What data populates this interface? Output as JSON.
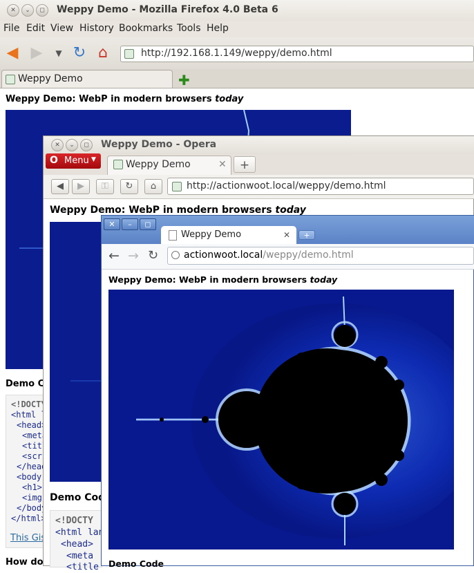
{
  "firefox": {
    "title": "Weppy Demo - Mozilla Firefox 4.0 Beta 6",
    "menu": [
      "File",
      "Edit",
      "View",
      "History",
      "Bookmarks",
      "Tools",
      "Help"
    ],
    "url": "http://192.168.1.149/weppy/demo.html",
    "tab_label": "Weppy Demo",
    "heading_main": "Weppy Demo: WebP in modern browsers ",
    "heading_em": "today",
    "demo_code_heading": "Demo Co",
    "code_lines": [
      "<!DOCTY",
      "<html lan",
      "<head>",
      "<meta",
      "<title",
      "<scrip",
      "</head",
      "<body",
      "<h1>",
      "<img",
      "</body",
      "</html>"
    ],
    "gist_link": "This Gis",
    "how_heading": "How doe"
  },
  "opera": {
    "title": "Weppy Demo - Opera",
    "menu_label": "Menu",
    "tab_label": "Weppy Demo",
    "url": "http://actionwoot.local/weppy/demo.html",
    "heading_main": "Weppy Demo: WebP in modern browsers ",
    "heading_em": "today",
    "demo_code_heading": "Demo Cod",
    "code_lines": [
      "<!DOCTY",
      "<html lan",
      "<head>",
      "<meta",
      "<title"
    ]
  },
  "chrome": {
    "tab_label": "Weppy Demo",
    "url_host": "actionwoot.local",
    "url_path": "/weppy/demo.html",
    "heading_main": "Weppy Demo: WebP in modern browsers ",
    "heading_em": "today",
    "demo_code_heading": "Demo Code"
  },
  "colors": {
    "fractal_bg": "#0a1a8c",
    "fractal_glow": "#3a7af0",
    "mandel_body": "#000000",
    "opera_red": "#c8161b"
  }
}
